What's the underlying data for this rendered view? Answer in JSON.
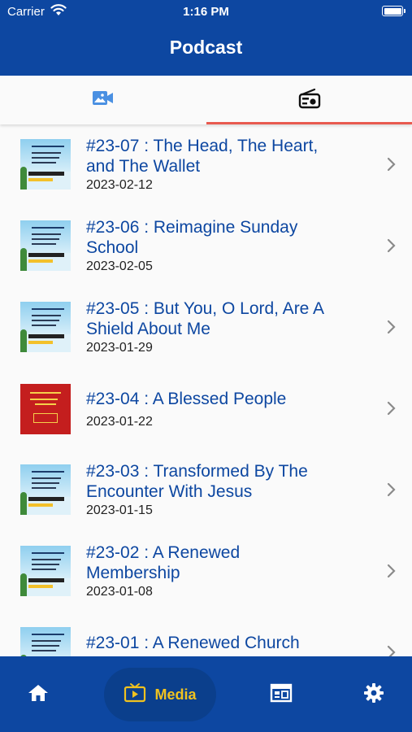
{
  "status_bar": {
    "carrier": "Carrier",
    "time": "1:16 PM"
  },
  "header": {
    "title": "Podcast"
  },
  "tabs": [
    {
      "icon": "video-icon",
      "color": "#4a90e2",
      "selected": false
    },
    {
      "icon": "radio-icon",
      "color": "#111111",
      "selected": true
    }
  ],
  "episodes": [
    {
      "title_line1": "#23-07 : The Head, The Heart,",
      "title_line2": "and The Wallet",
      "date": "2023-02-12",
      "thumb": "light"
    },
    {
      "title_line1": "#23-06 : Reimagine Sunday",
      "title_line2": "School",
      "date": "2023-02-05",
      "thumb": "light"
    },
    {
      "title_line1": "#23-05 : But You, O Lord, Are A",
      "title_line2": "Shield About Me",
      "date": "2023-01-29",
      "thumb": "light"
    },
    {
      "title_line1": "#23-04 : A Blessed People",
      "title_line2": "",
      "date": "2023-01-22",
      "thumb": "red"
    },
    {
      "title_line1": "#23-03 : Transformed By The",
      "title_line2": "Encounter With Jesus",
      "date": "2023-01-15",
      "thumb": "light"
    },
    {
      "title_line1": "#23-02 : A Renewed",
      "title_line2": "Membership",
      "date": "2023-01-08",
      "thumb": "light"
    },
    {
      "title_line1": "#23-01 : A Renewed Church",
      "title_line2": "",
      "date": "",
      "thumb": "light"
    }
  ],
  "bottom_nav": {
    "home_icon": "home-icon",
    "media_label": "Media",
    "schedule_icon": "schedule-icon",
    "settings_icon": "gear-icon",
    "active_color": "#f0c21f"
  },
  "colors": {
    "primary": "#0d47a1",
    "accent_indicator": "#e85a4f",
    "title_text": "#0d47a1"
  }
}
